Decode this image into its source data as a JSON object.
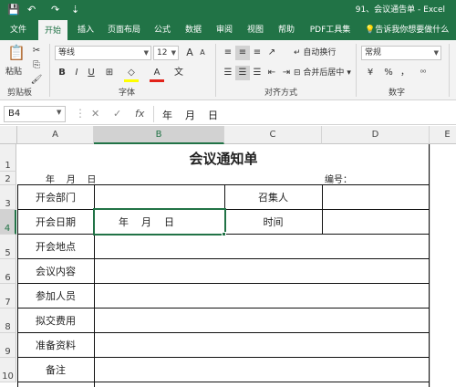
{
  "titlebar": {
    "save_icon": "💾",
    "undo_icon": "↶",
    "redo_icon": "↷",
    "customize_icon": "⇣",
    "title": "91、会议通告单  -  Excel"
  },
  "tabs": [
    "文件",
    "开始",
    "插入",
    "页面布局",
    "公式",
    "数据",
    "审阅",
    "视图",
    "帮助",
    "PDF工具集"
  ],
  "tellme": "告诉我你想要做什么",
  "ribbon": {
    "paste_label": "粘贴",
    "clipboard_label": "剪贴板",
    "font_name": "等线",
    "font_size": "12",
    "grow_font": "A",
    "shrink_font": "A",
    "bold": "B",
    "italic": "I",
    "underline": "U",
    "font_label": "字体",
    "wrap_text": "自动换行",
    "merge_center": "合并后居中",
    "align_label": "对齐方式",
    "number_format": "常规",
    "percent": "%",
    "comma": "，",
    "number_label": "数字"
  },
  "formulabar": {
    "name_box": "B4",
    "cancel": "✕",
    "enter": "✓",
    "fx": "fx",
    "content": "年    月    日"
  },
  "columns": [
    "A",
    "B",
    "C",
    "D",
    "E"
  ],
  "rows": [
    "1",
    "2",
    "3",
    "4",
    "5",
    "6",
    "7",
    "8",
    "9",
    "10"
  ],
  "cells": {
    "title": "会议通知单",
    "a2": "年    月    日",
    "d2": "编号：",
    "a3": "开会部门",
    "c3": "召集人",
    "a4": "开会日期",
    "b4": "年    月    日",
    "c4": "时间",
    "a5": "开会地点",
    "a6": "会议内容",
    "a7": "参加人员",
    "a8": "拟交费用",
    "a9": "准备资料",
    "a10": "备注"
  },
  "colors": {
    "brand_green": "#217346",
    "ribbon_bg": "#f3f3f3",
    "font_color_red": "#e2231a",
    "highlight_yellow": "#ffff00"
  }
}
